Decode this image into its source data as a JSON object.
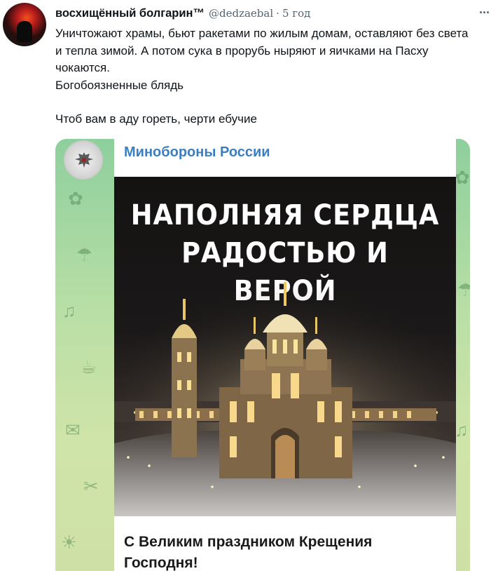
{
  "tweet": {
    "author": {
      "display_name": "восхищённый болгарин™",
      "handle": "@dedzaebal",
      "separator": "·",
      "time": "5 год",
      "avatar_icon": "avatar-image"
    },
    "more_icon": "more-options-icon",
    "text_lines": [
      "Уничтожают храмы, бьют ракетами по жилым домам, оставляют без света и тепла зимой. А потом сука в прорубь ныряют и яичками на Пасху чокаются.",
      "Богобоязненные блядь",
      "Чтоб вам в аду гореть, черти ебучие"
    ]
  },
  "media": {
    "channel_name": "Минобороны России",
    "channel_icon": "ministry-emblem-icon",
    "poster_headline_line1": "НАПОЛНЯЯ СЕРДЦА",
    "poster_headline_line2": "РАДОСТЬЮ И ВЕРОЙ",
    "caption": "С Великим праздником Крещения Господня!",
    "colors": {
      "channel_name": "#3a7fc1",
      "wallpaper": "#b9dfa6"
    }
  }
}
